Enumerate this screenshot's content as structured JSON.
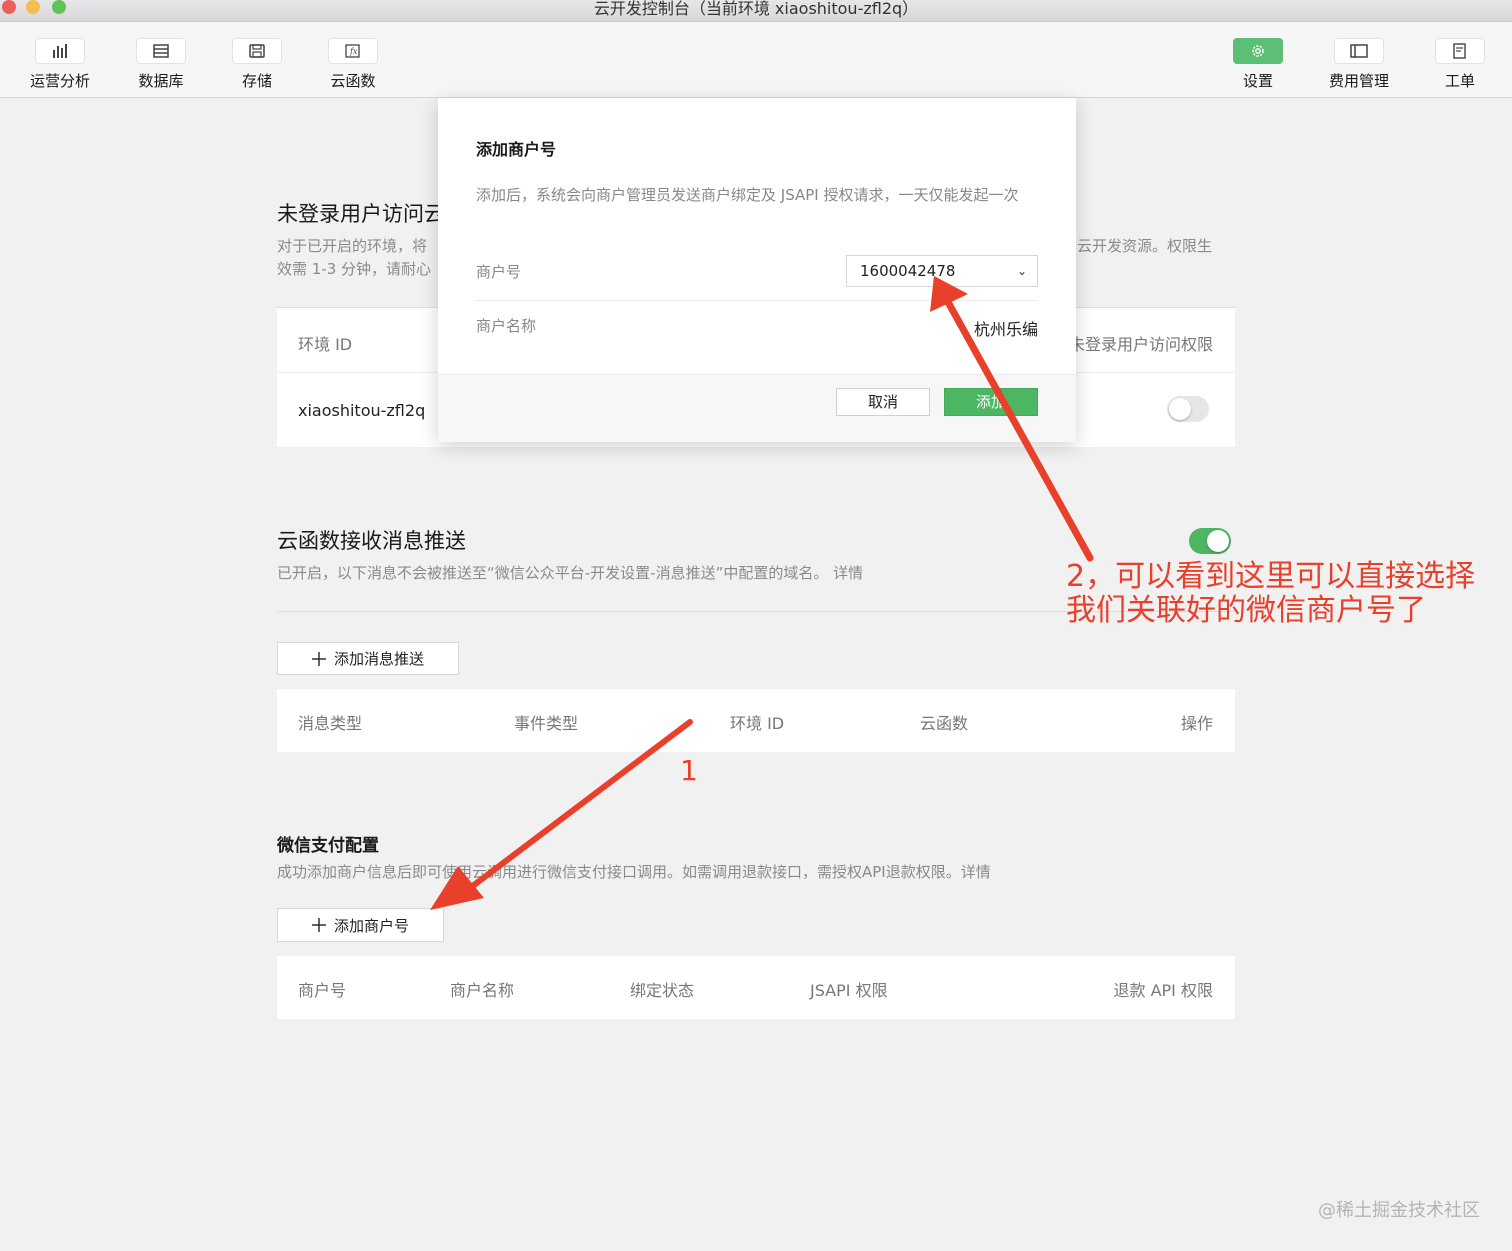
{
  "window": {
    "title": "云开发控制台（当前环境 xiaoshitou-zfl2q）"
  },
  "toolbar": {
    "left": [
      {
        "label": "运营分析",
        "icon": "bar-chart-icon"
      },
      {
        "label": "数据库",
        "icon": "database-icon"
      },
      {
        "label": "存储",
        "icon": "storage-icon"
      },
      {
        "label": "云函数",
        "icon": "function-icon"
      }
    ],
    "right": [
      {
        "label": "设置",
        "icon": "gear-icon",
        "active": true
      },
      {
        "label": "费用管理",
        "icon": "billing-icon"
      },
      {
        "label": "工单",
        "icon": "ticket-icon"
      }
    ]
  },
  "unauth_section": {
    "title": "未登录用户访问云",
    "desc_line1": "对于已开启的环境，将",
    "desc_line1_right": "问云开发资源。权限生",
    "desc_line2": "效需 1-3 分钟，请耐心",
    "table": {
      "col_env": "环境 ID",
      "col_access": "未登录用户访问权限",
      "row_env": "xiaoshitou-zfl2q",
      "toggle_on": false
    }
  },
  "push_section": {
    "title": "云函数接收消息推送",
    "desc": "已开启，以下消息不会被推送至“微信公众平台-开发设置-消息推送”中配置的域名。 详情",
    "toggle_on": true,
    "add_button": "添加消息推送",
    "columns": [
      "消息类型",
      "事件类型",
      "环境 ID",
      "云函数",
      "操作"
    ]
  },
  "pay_section": {
    "title": "微信支付配置",
    "desc": "成功添加商户信息后即可使用云调用进行微信支付接口调用。如需调用退款接口，需授权API退款权限。详情",
    "add_button": "添加商户号",
    "columns": [
      "商户号",
      "商户名称",
      "绑定状态",
      "JSAPI 权限",
      "退款 API 权限"
    ]
  },
  "modal": {
    "title": "添加商户号",
    "desc": "添加后，系统会向商户管理员发送商户绑定及 JSAPI 授权请求，一天仅能发起一次",
    "merchant_id_label": "商户号",
    "merchant_id_value": "1600042478",
    "merchant_name_label": "商户名称",
    "merchant_name_value": "杭州乐编",
    "cancel": "取消",
    "confirm": "添加"
  },
  "annotations": {
    "label_1": "1",
    "label_2_line1": "2，可以看到这里可以直接选择",
    "label_2_line2": "我们关联好的微信商户号了",
    "color": "#e8402b"
  },
  "watermark": "@稀土掘金技术社区"
}
